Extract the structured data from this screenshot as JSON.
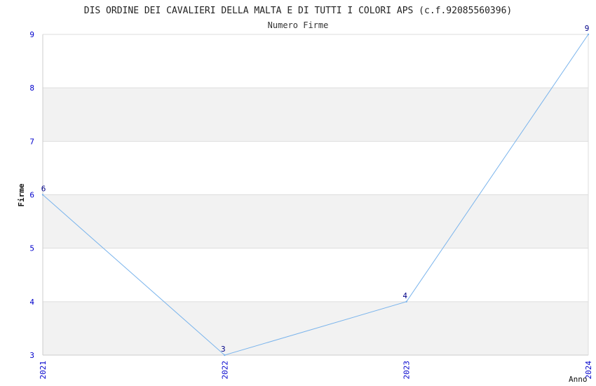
{
  "chart_data": {
    "type": "line",
    "title": "DIS ORDINE DEI CAVALIERI DELLA MALTA E DI TUTTI I COLORI APS (c.f.92085560396)",
    "subtitle": "Numero Firme",
    "xlabel": "Anno",
    "ylabel": "Firme",
    "categories": [
      "2021",
      "2022",
      "2023",
      "2024"
    ],
    "values": [
      6,
      3,
      4,
      9
    ],
    "ylim": [
      3,
      9
    ],
    "yticks": [
      "3",
      "4",
      "5",
      "6",
      "7",
      "8",
      "9"
    ],
    "grid": true,
    "colors": {
      "line": "#7ab4ec",
      "tick_text": "#0000cc",
      "band": "#f2f2f2",
      "grid": "#dddddd",
      "title": "#222222",
      "axis_label": "#111111"
    }
  }
}
